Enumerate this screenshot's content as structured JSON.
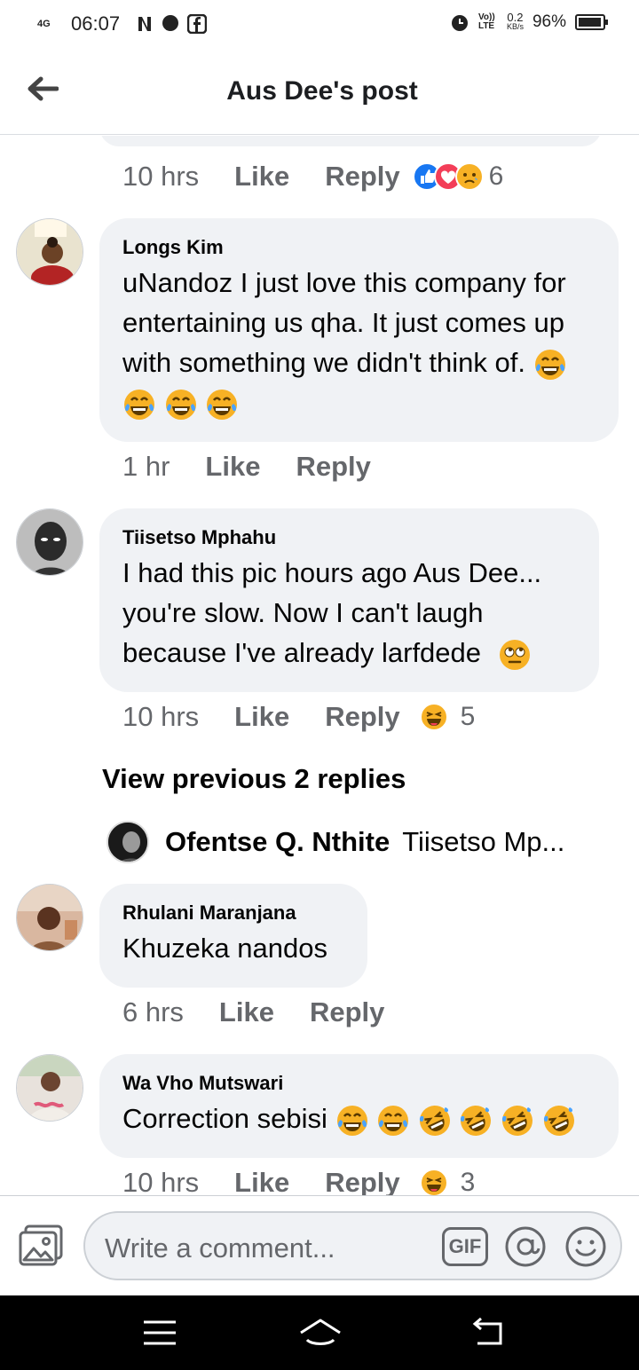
{
  "status_bar": {
    "network": "4G",
    "time": "06:07",
    "volte": "Vo)) LTE",
    "speed_value": "0.2",
    "speed_unit": "KB/s",
    "battery": "96%",
    "battery_level": 0.96
  },
  "header": {
    "title": "Aus Dee's post"
  },
  "top_meta": {
    "time": "10 hrs",
    "like": "Like",
    "reply": "Reply",
    "reaction_count": "6"
  },
  "comments": [
    {
      "author": "Longs Kim",
      "text": "uNandoz I just love this company for entertaining us qha. It just comes up with something we didn't think of.",
      "time": "1 hr",
      "like": "Like",
      "reply": "Reply"
    },
    {
      "author": "Tiisetso Mphahu",
      "text": "I had this pic hours ago Aus Dee... you're slow. Now I can't laugh because I've already larfdede",
      "time": "10 hrs",
      "like": "Like",
      "reply": "Reply",
      "reaction_count": "5"
    },
    {
      "author": "Rhulani Maranjana",
      "text": "Khuzeka nandos",
      "time": "6 hrs",
      "like": "Like",
      "reply": "Reply"
    },
    {
      "author": "Wa Vho Mutswari",
      "text": "Correction sebisi",
      "time": "10 hrs",
      "like": "Like",
      "reply": "Reply",
      "reaction_count": "3"
    }
  ],
  "view_previous": "View previous 2 replies",
  "reply_preview": {
    "author": "Ofentse Q. Nthite",
    "text": "Tiisetso Mp..."
  },
  "composer": {
    "placeholder": "Write a comment...",
    "gif_label": "GIF"
  },
  "colors": {
    "bubble": "#f0f2f5",
    "secondary_text": "#65676b",
    "like_blue": "#1877f2",
    "love_red": "#f33e58",
    "emoji_yellow": "#f7b125"
  }
}
